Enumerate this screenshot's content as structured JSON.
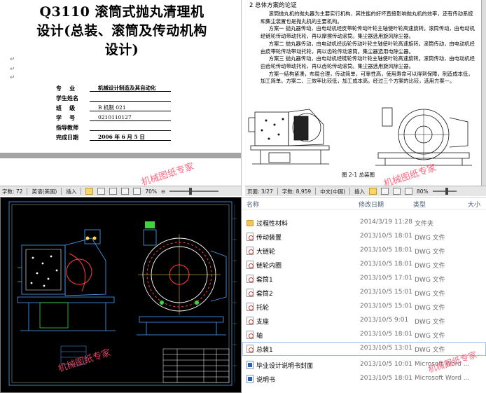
{
  "cover": {
    "title_lines": [
      "Q3110 滚筒式抛丸清理机",
      "设计(总装、滚筒及传动机构",
      "设计)"
    ],
    "fields": [
      {
        "key": "专    业",
        "value": "机械设计制造及其自动化"
      },
      {
        "key": "学生姓名",
        "value": ""
      },
      {
        "key": "班    级",
        "value": "B 机制 021"
      },
      {
        "key": "学    号",
        "value": "0210110127"
      },
      {
        "key": "指导教师",
        "value": ""
      },
      {
        "key": "完成日期",
        "value": "2006 年 6 月 5 日"
      }
    ]
  },
  "watermark": "机械图纸专家",
  "statusbar_left": {
    "pages": "字数: 72",
    "lang": "英语(美国)",
    "mode": "插入",
    "zoom": "70%"
  },
  "statusbar_right": {
    "pages": "页面: 3/27",
    "words": "字数: 8,959",
    "lang": "中文(中国)",
    "mode": "插入",
    "zoom": "80%"
  },
  "content_page": {
    "section_head": "2  总体方案的论证",
    "paragraphs": [
      "滚筒抛丸机的抛丸器为主要实行机构，其性能的好坏直接影响抛丸机的效率，还有传动系统和集尘装置也是抛丸机的主要机构。",
      "方案一   抛丸器传动，由电动机经皮带轮传动叶轮主轴使叶轮高速旋转。滚筒传动，由电动机经链轮传动带动托轮，再以摩擦传动滚筒。集尘器选用旋风除尘器。",
      "方案二   抛丸器传动，由电动机经齿轮传动叶轮主轴使叶轮高速旋转。滚筒传动，由电动机经由皮带轮传动带动托轮，再以齿轮传动滚筒。集尘器选用电除尘器。",
      "方案三   抛丸器传动，由电动机经链轮传动叶轮主轴使叶轮高速旋转。滚筒传动，由电动机经由齿轮传动带动托轮，再以齿轮传动滚筒。集尘器选用旋风除尘器。",
      "方案一结构紧凑，布局合理，传动简单，可靠性高，使用寿命可以得到保障，制造成本低，加工简单。方案二、三效率比较低，加工成本高。经过三个方案的比较，选用方案一。"
    ],
    "figure_caption": "图 2-1  总装图"
  },
  "explorer": {
    "columns": {
      "name": "名称",
      "date": "修改日期",
      "type": "类型",
      "size": "大小"
    },
    "rows": [
      {
        "name": "过程性材料",
        "date": "2014/3/19 11:28",
        "type": "文件夹",
        "icon": "folder-icon"
      },
      {
        "name": "传动装置",
        "date": "2013/10/5 18:01",
        "type": "DWG 文件",
        "icon": "dwg-file-icon"
      },
      {
        "name": "大链轮",
        "date": "2013/10/5 18:01",
        "type": "DWG 文件",
        "icon": "dwg-file-icon"
      },
      {
        "name": "链轮内圈",
        "date": "2013/10/5 18:01",
        "type": "DWG 文件",
        "icon": "dwg-file-icon"
      },
      {
        "name": "套筒1",
        "date": "2013/10/5 17:01",
        "type": "DWG 文件",
        "icon": "dwg-file-icon"
      },
      {
        "name": "套筒2",
        "date": "2013/10/5 15:01",
        "type": "DWG 文件",
        "icon": "dwg-file-icon"
      },
      {
        "name": "托轮",
        "date": "2013/10/5 15:01",
        "type": "DWG 文件",
        "icon": "dwg-file-icon"
      },
      {
        "name": "支座",
        "date": "2013/10/5 9:01",
        "type": "DWG 文件",
        "icon": "dwg-file-icon"
      },
      {
        "name": "轴",
        "date": "2013/10/5 18:01",
        "type": "DWG 文件",
        "icon": "dwg-file-icon"
      },
      {
        "name": "总装1",
        "date": "2013/10/5 13:01",
        "type": "DWG 文件",
        "icon": "dwg-file-icon"
      },
      {
        "name": "毕业设计说明书封面",
        "date": "2013/10/5 10:01",
        "type": "Microsoft Word ...",
        "icon": "word-file-icon"
      },
      {
        "name": "说明书",
        "date": "2013/10/5 18:01",
        "type": "Microsoft Word ...",
        "icon": "word-file-icon"
      }
    ]
  }
}
